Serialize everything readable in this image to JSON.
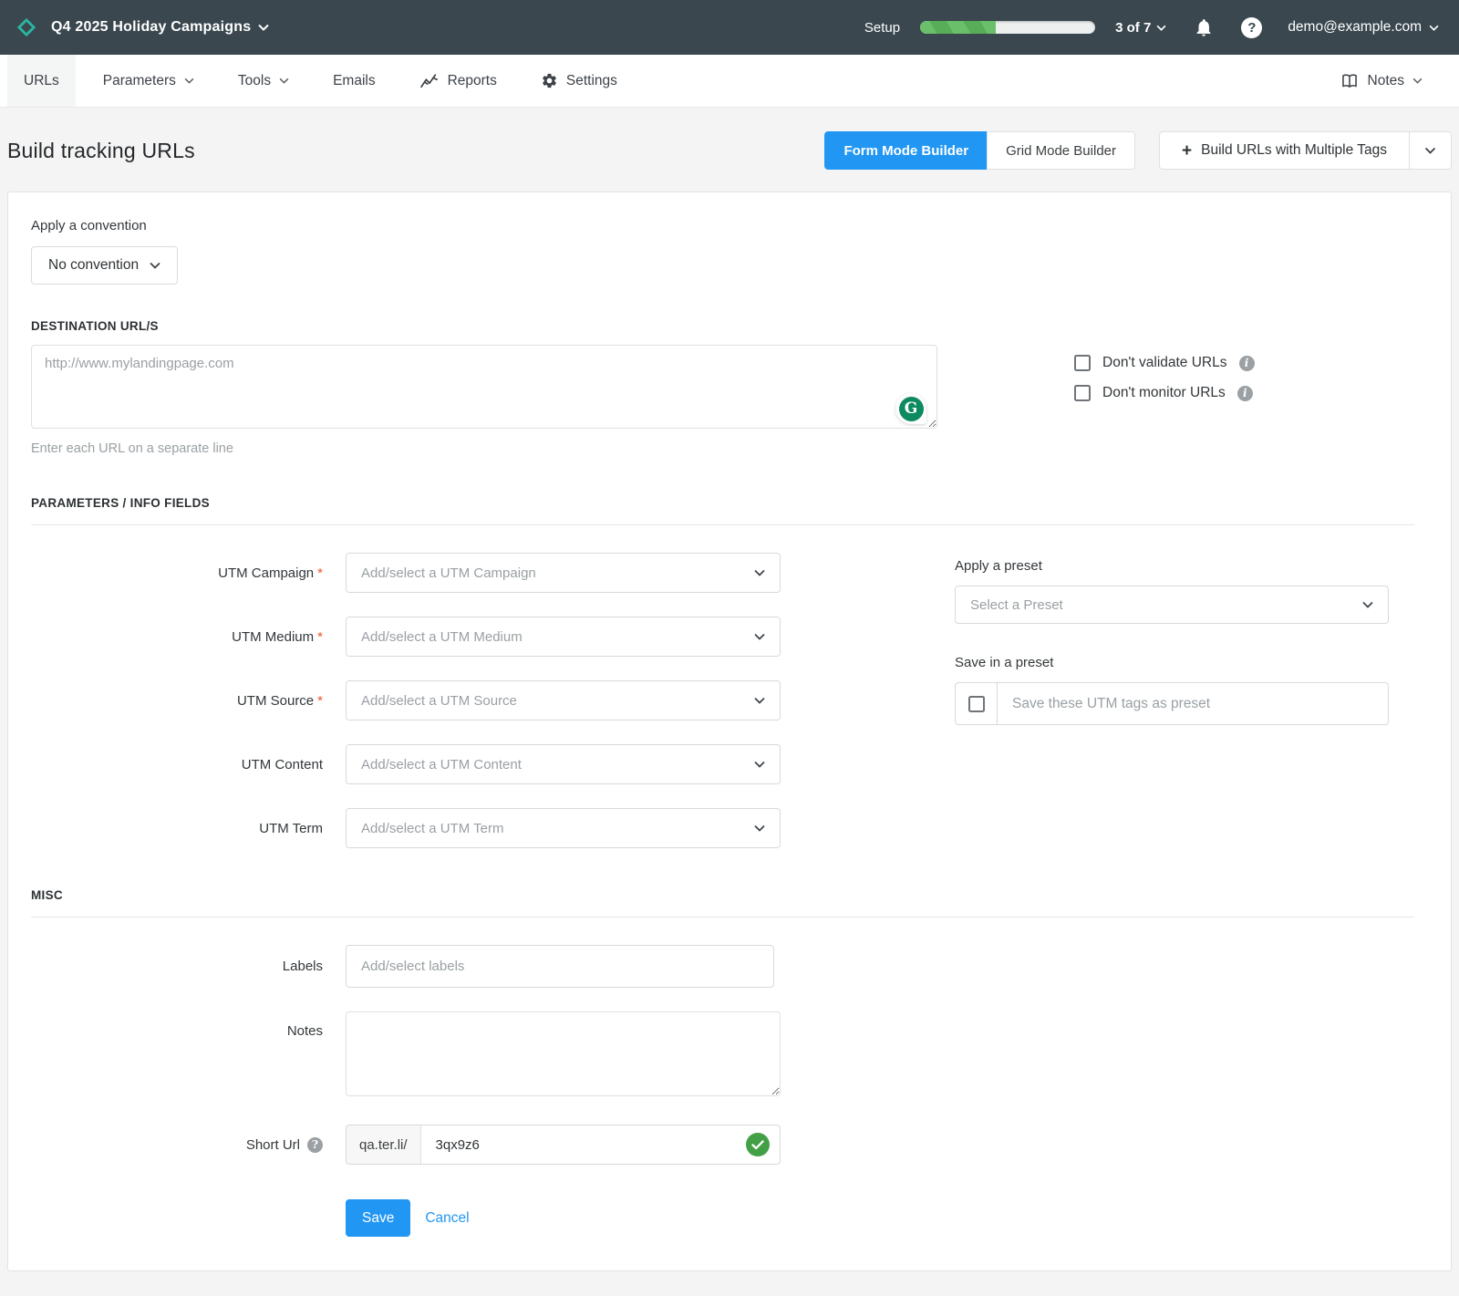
{
  "topbar": {
    "project_title": "Q4 2025 Holiday Campaigns",
    "setup_label": "Setup",
    "progress": {
      "label": "3 of 7",
      "percent": 43
    },
    "user_email": "demo@example.com",
    "help_glyph": "?"
  },
  "nav": {
    "items": [
      {
        "label": "URLs"
      },
      {
        "label": "Parameters"
      },
      {
        "label": "Tools"
      },
      {
        "label": "Emails"
      },
      {
        "label": "Reports"
      },
      {
        "label": "Settings"
      }
    ],
    "notes_label": "Notes"
  },
  "page": {
    "title": "Build tracking URLs",
    "form_mode_label": "Form Mode Builder",
    "grid_mode_label": "Grid Mode Builder",
    "multi_tags_plus": "+",
    "multi_tags_label": "Build URLs with Multiple Tags"
  },
  "convention": {
    "label": "Apply a convention",
    "selected": "No convention"
  },
  "destination": {
    "heading": "DESTINATION URL/S",
    "placeholder": "http://www.mylandingpage.com",
    "helper": "Enter each URL on a separate line",
    "grammarly_glyph": "G",
    "checkboxes": [
      {
        "label": "Don't validate URLs",
        "checked": false
      },
      {
        "label": "Don't monitor URLs",
        "checked": false
      }
    ],
    "info_glyph": "i"
  },
  "parameters": {
    "heading": "PARAMETERS / INFO FIELDS",
    "required_marker": "*",
    "fields": [
      {
        "label": "UTM Campaign",
        "required": true,
        "placeholder": "Add/select a UTM Campaign"
      },
      {
        "label": "UTM Medium",
        "required": true,
        "placeholder": "Add/select a UTM Medium"
      },
      {
        "label": "UTM Source",
        "required": true,
        "placeholder": "Add/select a UTM Source"
      },
      {
        "label": "UTM Content",
        "required": false,
        "placeholder": "Add/select a UTM Content"
      },
      {
        "label": "UTM Term",
        "required": false,
        "placeholder": "Add/select a UTM Term"
      }
    ]
  },
  "presets": {
    "apply_label": "Apply a preset",
    "select_placeholder": "Select a Preset",
    "save_label": "Save in a preset",
    "save_placeholder": "Save these UTM tags as preset",
    "save_checked": false
  },
  "misc": {
    "heading": "MISC",
    "labels_label": "Labels",
    "labels_placeholder": "Add/select labels",
    "notes_label": "Notes",
    "notes_value": "",
    "shorturl_label": "Short Url",
    "shorturl_help_glyph": "?",
    "shorturl_domain": "qa.ter.li/",
    "shorturl_value": "3qx9z6",
    "shorturl_status": "valid"
  },
  "actions": {
    "save_label": "Save",
    "cancel_label": "Cancel"
  },
  "colors": {
    "topbar_bg": "#3a474f",
    "accent_blue": "#2196f3",
    "brand_teal": "#2bb5a0",
    "progress_green": "#58ae58",
    "valid_green": "#43a047",
    "grammarly_green": "#0e8a60",
    "required_red": "#f4511e"
  }
}
